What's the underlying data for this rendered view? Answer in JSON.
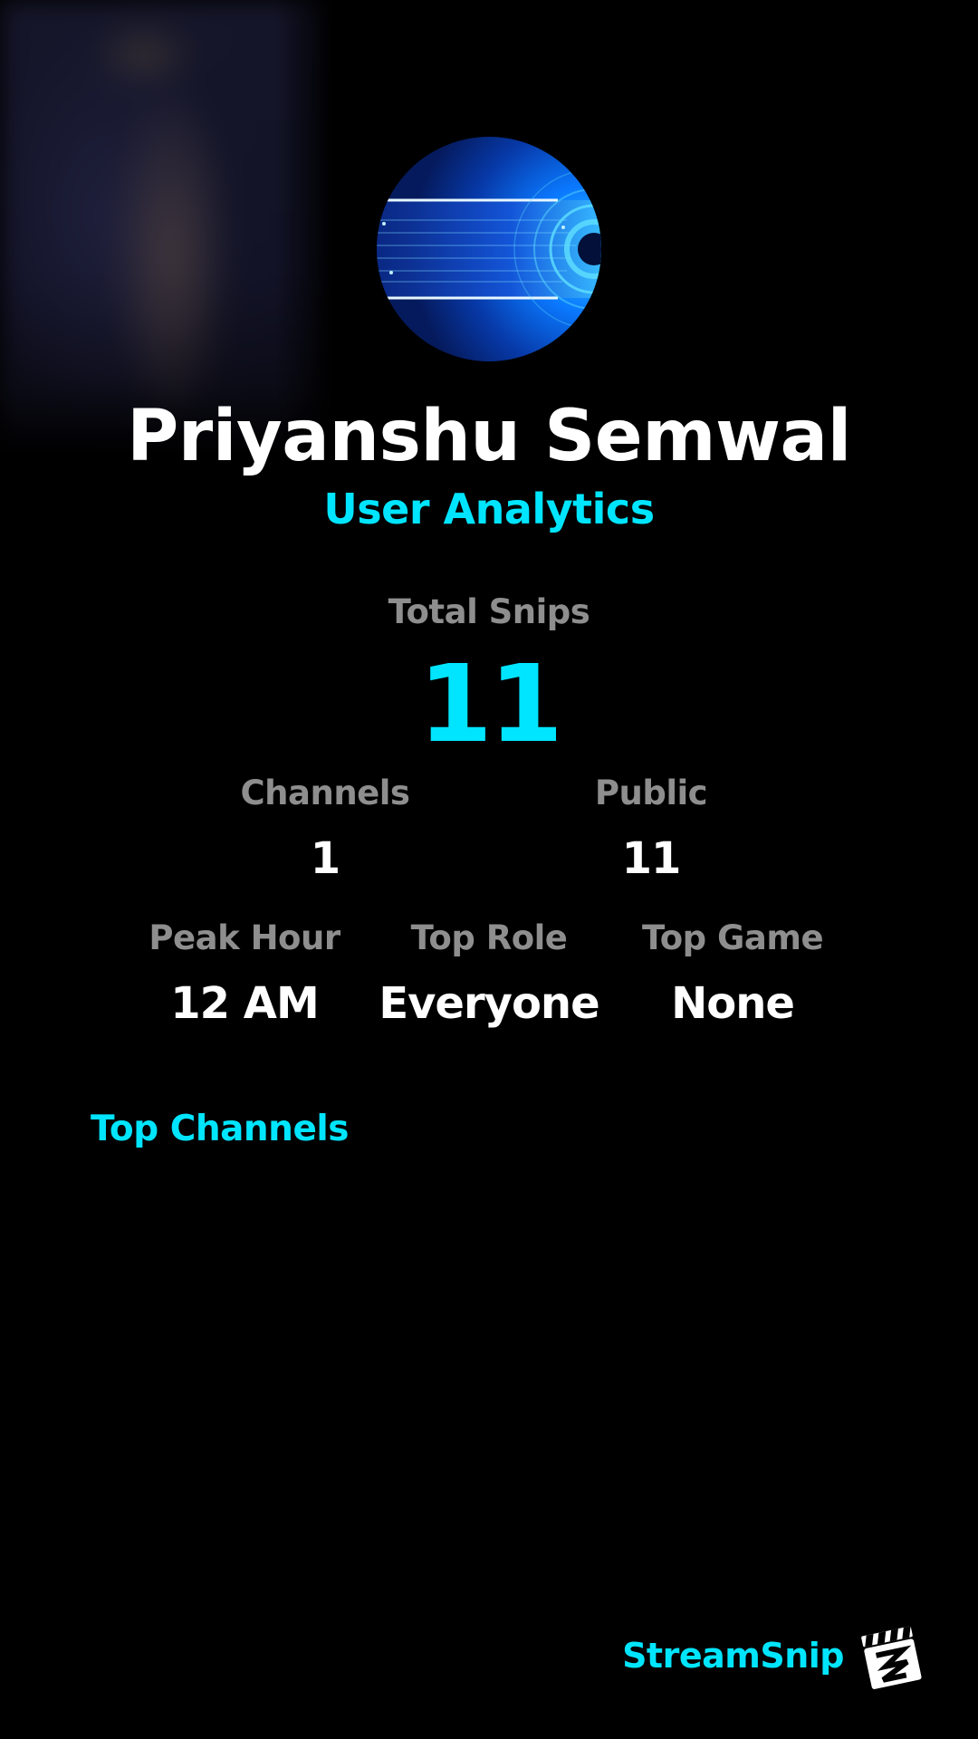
{
  "profile": {
    "name": "Priyanshu Semwal",
    "subtitle": "User Analytics"
  },
  "stats": {
    "total_snips": {
      "label": "Total Snips",
      "value": "11"
    },
    "channels": {
      "label": "Channels",
      "value": "1"
    },
    "public": {
      "label": "Public",
      "value": "11"
    },
    "peak_hour": {
      "label": "Peak Hour",
      "value": "12 AM"
    },
    "top_role": {
      "label": "Top Role",
      "value": "Everyone"
    },
    "top_game": {
      "label": "Top Game",
      "value": "None"
    }
  },
  "top_channels": {
    "title": "Top Channels",
    "items": []
  },
  "brand": {
    "name": "StreamSnip",
    "logo_icon": "clapperboard-icon"
  },
  "colors": {
    "background": "#000000",
    "accent": "#00e5ff",
    "label_gray": "#8e8e8e",
    "value_white": "#ffffff"
  }
}
